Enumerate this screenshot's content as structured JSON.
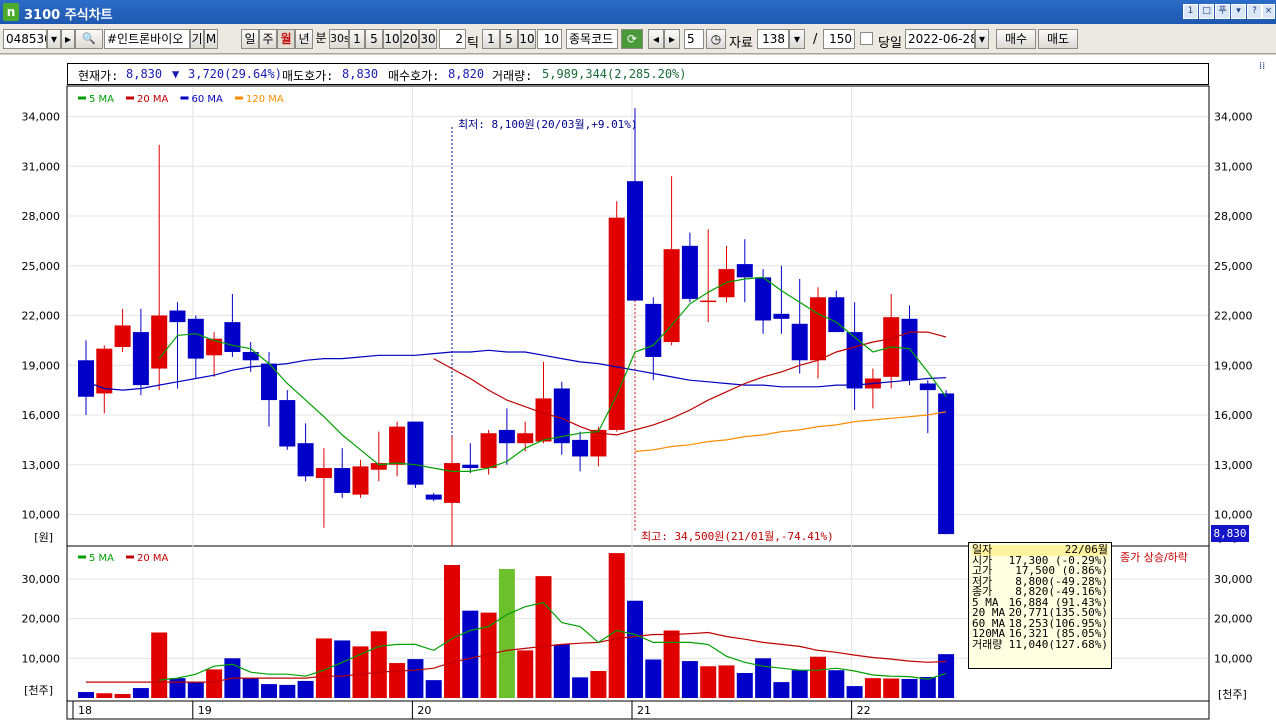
{
  "window": {
    "title": "3100 주식차트",
    "logo": "n",
    "controls": [
      "1",
      "□",
      "푸",
      "▾",
      "?",
      "×"
    ]
  },
  "toolbar": {
    "stock_code": "048530",
    "stock_name": "#인트론바이오",
    "gi": "기",
    "m": "M",
    "periods": [
      "일",
      "주",
      "월",
      "년",
      "분"
    ],
    "minute_options": [
      "30s",
      "1",
      "5",
      "10",
      "20",
      "30"
    ],
    "tick_input": "2",
    "tick_label": "틱",
    "tick_options": [
      "1",
      "5",
      "10"
    ],
    "tick_value": "10",
    "code_label": "종목코드",
    "step_value": "5",
    "data_label": "자료",
    "data_count": "138",
    "slash": "/",
    "data_total": "150",
    "today_label": "당일",
    "date": "2022-06-28",
    "buy_label": "매수",
    "sell_label": "매도"
  },
  "info": {
    "current_label": "현재가:",
    "current_value": "8,830",
    "change_arrow": "▼",
    "change_value": "3,720(29.64%)",
    "ask_label": "매도호가:",
    "ask_value": "8,830",
    "bid_label": "매수호가:",
    "bid_value": "8,820",
    "volume_label": "거래량:",
    "volume_value": "5,989,344(2,285.20%)"
  },
  "price_legend": [
    {
      "label": "5 MA",
      "color": "#00a000"
    },
    {
      "label": "20 MA",
      "color": "#c00000"
    },
    {
      "label": "60 MA",
      "color": "#0000c0"
    },
    {
      "label": "120 MA",
      "color": "#ff8c00"
    }
  ],
  "volume_legend": [
    {
      "label": "5 MA",
      "color": "#00a000"
    },
    {
      "label": "20 MA",
      "color": "#c00000"
    }
  ],
  "price_axis": {
    "ticks": [
      "34,000",
      "31,000",
      "28,000",
      "25,000",
      "22,000",
      "19,000",
      "16,000",
      "13,000",
      "10,000"
    ],
    "unit": "[원]",
    "unit_right": "[원]"
  },
  "volume_axis": {
    "ticks": [
      "30,000",
      "20,000",
      "10,000"
    ],
    "unit": "[천주]",
    "unit_right": "[천주]"
  },
  "x_axis": {
    "labels": [
      "18",
      "19",
      "20",
      "21",
      "22"
    ]
  },
  "annotations": {
    "low": "최저: 8,100원(20/03월,+9.01%)",
    "high": "최고: 34,500원(21/01월,-74.41%)"
  },
  "current_price_badge": "8,830",
  "volume_caption": "종가 상승/하락",
  "tooltip": [
    {
      "label": "일자",
      "value": "22/06월"
    },
    {
      "label": "시가",
      "value": "17,300 (-0.29%)"
    },
    {
      "label": "고가",
      "value": "17,500 (0.86%)"
    },
    {
      "label": "저가",
      "value": "8,800(-49.28%)"
    },
    {
      "label": "종가",
      "value": "8,820(-49.16%)"
    },
    {
      "label": "5 MA",
      "value": "16,884 (91.43%)"
    },
    {
      "label": "20 MA",
      "value": "20,771(135.50%)"
    },
    {
      "label": "60 MA",
      "value": "18,253(106.95%)"
    },
    {
      "label": "120MA",
      "value": "16,321 (85.05%)"
    },
    {
      "label": "거래량",
      "value": "11,040(127.68%)"
    }
  ],
  "colors": {
    "up": "#e00000",
    "down": "#0000c8",
    "highlight": "#6cc02c",
    "grid": "#e4e4e4"
  },
  "chart_data": {
    "type": "candlestick",
    "period": "monthly",
    "ylim": [
      8000,
      35000
    ],
    "candles": [
      {
        "o": 19300,
        "h": 20500,
        "l": 16000,
        "c": 17100
      },
      {
        "o": 17300,
        "h": 20200,
        "l": 16100,
        "c": 20000
      },
      {
        "o": 20100,
        "h": 22400,
        "l": 19800,
        "c": 21400
      },
      {
        "o": 21000,
        "h": 22400,
        "l": 17200,
        "c": 17800
      },
      {
        "o": 18800,
        "h": 32300,
        "l": 17500,
        "c": 22000
      },
      {
        "o": 22300,
        "h": 22800,
        "l": 17600,
        "c": 21600
      },
      {
        "o": 21800,
        "h": 22000,
        "l": 18200,
        "c": 19400
      },
      {
        "o": 19600,
        "h": 21000,
        "l": 18300,
        "c": 20600
      },
      {
        "o": 21600,
        "h": 23300,
        "l": 19500,
        "c": 19800
      },
      {
        "o": 19800,
        "h": 20400,
        "l": 18600,
        "c": 19300
      },
      {
        "o": 19100,
        "h": 19800,
        "l": 15300,
        "c": 16900
      },
      {
        "o": 16900,
        "h": 17500,
        "l": 13900,
        "c": 14100
      },
      {
        "o": 14300,
        "h": 15500,
        "l": 12000,
        "c": 12300
      },
      {
        "o": 12200,
        "h": 14000,
        "l": 9200,
        "c": 12800
      },
      {
        "o": 12800,
        "h": 14000,
        "l": 11000,
        "c": 11300
      },
      {
        "o": 11200,
        "h": 13300,
        "l": 11000,
        "c": 12900
      },
      {
        "o": 12700,
        "h": 15000,
        "l": 12000,
        "c": 13100
      },
      {
        "o": 13000,
        "h": 15600,
        "l": 12300,
        "c": 15300
      },
      {
        "o": 15600,
        "h": 15600,
        "l": 11600,
        "c": 11800
      },
      {
        "o": 11200,
        "h": 11300,
        "l": 10800,
        "c": 10900
      },
      {
        "o": 10700,
        "h": 14700,
        "l": 8100,
        "c": 13100
      },
      {
        "o": 13000,
        "h": 14300,
        "l": 12500,
        "c": 12800
      },
      {
        "o": 12800,
        "h": 15100,
        "l": 12400,
        "c": 14900
      },
      {
        "o": 15100,
        "h": 16400,
        "l": 13000,
        "c": 14300
      },
      {
        "o": 14300,
        "h": 15600,
        "l": 13800,
        "c": 14900
      },
      {
        "o": 14400,
        "h": 19200,
        "l": 14300,
        "c": 17000
      },
      {
        "o": 17600,
        "h": 18000,
        "l": 13600,
        "c": 14300
      },
      {
        "o": 14500,
        "h": 15000,
        "l": 12600,
        "c": 13500
      },
      {
        "o": 13500,
        "h": 15300,
        "l": 12900,
        "c": 15100
      },
      {
        "o": 15100,
        "h": 28900,
        "l": 15000,
        "c": 27900
      },
      {
        "o": 30100,
        "h": 34500,
        "l": 22900,
        "c": 22900
      },
      {
        "o": 22700,
        "h": 23100,
        "l": 18100,
        "c": 19500
      },
      {
        "o": 20400,
        "h": 30400,
        "l": 20200,
        "c": 26000
      },
      {
        "o": 26200,
        "h": 27000,
        "l": 22800,
        "c": 23000
      },
      {
        "o": 22900,
        "h": 27200,
        "l": 21600,
        "c": 22900
      },
      {
        "o": 23100,
        "h": 26200,
        "l": 22800,
        "c": 24800
      },
      {
        "o": 25100,
        "h": 26600,
        "l": 22800,
        "c": 24300
      },
      {
        "o": 24300,
        "h": 24800,
        "l": 20900,
        "c": 21700
      },
      {
        "o": 22100,
        "h": 25000,
        "l": 20900,
        "c": 21800
      },
      {
        "o": 21500,
        "h": 24200,
        "l": 18500,
        "c": 19300
      },
      {
        "o": 19300,
        "h": 23700,
        "l": 18200,
        "c": 23100
      },
      {
        "o": 23100,
        "h": 23500,
        "l": 21000,
        "c": 21000
      },
      {
        "o": 21000,
        "h": 22800,
        "l": 16300,
        "c": 17600
      },
      {
        "o": 17600,
        "h": 18800,
        "l": 16400,
        "c": 18200
      },
      {
        "o": 18300,
        "h": 23300,
        "l": 17600,
        "c": 21900
      },
      {
        "o": 21800,
        "h": 22600,
        "l": 17800,
        "c": 18100
      },
      {
        "o": 17900,
        "h": 18100,
        "l": 14900,
        "c": 17500
      },
      {
        "o": 17300,
        "h": 17500,
        "l": 8800,
        "c": 8820
      }
    ],
    "ma5": [
      null,
      null,
      null,
      null,
      19400,
      20800,
      20900,
      20500,
      20200,
      20000,
      19100,
      17900,
      16900,
      15900,
      14800,
      13900,
      13000,
      13100,
      13000,
      12800,
      12600,
      12600,
      12800,
      13200,
      14000,
      14500,
      14700,
      14900,
      15000,
      17200,
      19800,
      20200,
      21400,
      22700,
      23400,
      24000,
      24200,
      24300,
      23500,
      22800,
      22100,
      21600,
      20700,
      19800,
      20100,
      20000,
      18600,
      17100
    ],
    "ma20": [
      null,
      null,
      null,
      null,
      null,
      null,
      null,
      null,
      null,
      null,
      null,
      null,
      null,
      null,
      null,
      null,
      null,
      null,
      null,
      19400,
      18800,
      18200,
      17500,
      16900,
      16500,
      16100,
      15800,
      15300,
      14900,
      14800,
      15100,
      15400,
      15800,
      16300,
      16900,
      17400,
      17900,
      18300,
      18600,
      19000,
      19300,
      19800,
      20100,
      20400,
      20600,
      21000,
      21000,
      20700
    ],
    "ma60": [
      18000,
      17600,
      17500,
      17600,
      17800,
      18000,
      18200,
      18400,
      18700,
      18900,
      19000,
      19100,
      19300,
      19400,
      19400,
      19500,
      19600,
      19600,
      19600,
      19700,
      19800,
      19800,
      19900,
      19800,
      19800,
      19600,
      19400,
      19200,
      19100,
      18900,
      18700,
      18500,
      18300,
      18100,
      18000,
      17900,
      17800,
      17800,
      17700,
      17700,
      17700,
      17800,
      17800,
      17900,
      18000,
      18100,
      18200,
      18250
    ],
    "ma120": [
      null,
      null,
      null,
      null,
      null,
      null,
      null,
      null,
      null,
      null,
      null,
      null,
      null,
      null,
      null,
      null,
      null,
      null,
      null,
      null,
      null,
      null,
      null,
      null,
      null,
      null,
      null,
      null,
      null,
      null,
      13800,
      13900,
      14100,
      14200,
      14400,
      14500,
      14700,
      14800,
      15000,
      15100,
      15300,
      15400,
      15600,
      15700,
      15800,
      15900,
      16000,
      16200
    ],
    "volume": [
      1500,
      1200,
      1000,
      2500,
      16500,
      5000,
      4000,
      7200,
      10000,
      5000,
      3500,
      3300,
      4300,
      15000,
      14500,
      13000,
      16800,
      8800,
      9800,
      4500,
      33500,
      22000,
      21500,
      32500,
      12000,
      30700,
      13500,
      5200,
      6800,
      36500,
      24500,
      9700,
      17000,
      9300,
      8000,
      8200,
      6300,
      10000,
      4000,
      7000,
      10400,
      7000,
      3000,
      5000,
      4900,
      4800,
      5300,
      11040
    ],
    "vol_ma5": [
      null,
      null,
      null,
      null,
      4500,
      5000,
      6000,
      8000,
      8500,
      6500,
      6000,
      6000,
      5500,
      7000,
      9000,
      11000,
      13000,
      13500,
      13500,
      12000,
      15000,
      17000,
      18000,
      21000,
      23000,
      24000,
      19000,
      18000,
      14000,
      17000,
      16000,
      14000,
      14000,
      14000,
      13500,
      10500,
      9000,
      8000,
      7500,
      7000,
      7000,
      7500,
      6800,
      5800,
      5500,
      5400,
      4700,
      6200
    ],
    "vol_ma20": [
      4000,
      4000,
      4000,
      4000,
      4000,
      4000,
      4000,
      4000,
      5000,
      5000,
      5000,
      5000,
      5000,
      5500,
      5500,
      6000,
      6500,
      6800,
      7000,
      7500,
      9000,
      10000,
      11000,
      12000,
      12500,
      13000,
      13500,
      13800,
      14000,
      15000,
      15500,
      16000,
      16000,
      16200,
      16500,
      15500,
      14800,
      14000,
      13500,
      13000,
      12000,
      11500,
      10800,
      10200,
      9800,
      9300,
      9000,
      9200
    ],
    "highlight_index": 23
  }
}
